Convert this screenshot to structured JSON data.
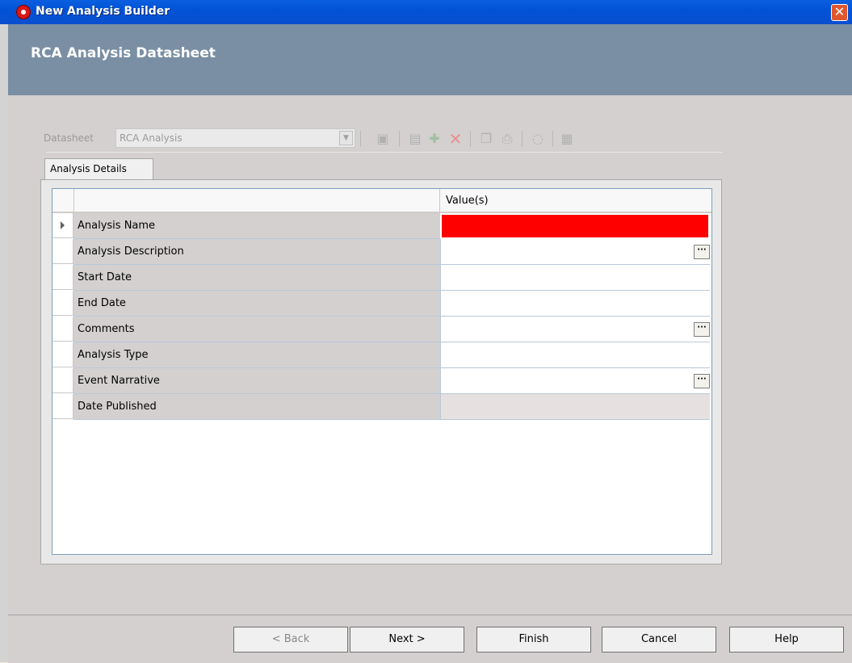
{
  "window": {
    "title": "New Analysis Builder",
    "close_glyph": "✕"
  },
  "header": {
    "title": "RCA Analysis Datasheet"
  },
  "datasheet": {
    "label": "Datasheet",
    "selected": "RCA Analysis"
  },
  "toolbar": {
    "icons": [
      "open-icon",
      "save-icon",
      "save-new-icon",
      "delete-icon",
      "copy-icon",
      "print-icon",
      "help-icon",
      "properties-icon"
    ]
  },
  "tabs": [
    {
      "label": "Analysis Details"
    }
  ],
  "grid": {
    "value_header": "Value(s)",
    "rows": [
      {
        "label": "Analysis Name",
        "value": "",
        "state": "required",
        "ellipsis": false,
        "current": true
      },
      {
        "label": "Analysis Description",
        "value": "",
        "state": "normal",
        "ellipsis": true,
        "current": false
      },
      {
        "label": "Start Date",
        "value": "",
        "state": "normal",
        "ellipsis": false,
        "current": false
      },
      {
        "label": "End Date",
        "value": "",
        "state": "normal",
        "ellipsis": false,
        "current": false
      },
      {
        "label": "Comments",
        "value": "",
        "state": "normal",
        "ellipsis": true,
        "current": false
      },
      {
        "label": "Analysis Type",
        "value": "",
        "state": "normal",
        "ellipsis": false,
        "current": false
      },
      {
        "label": "Event Narrative",
        "value": "",
        "state": "normal",
        "ellipsis": true,
        "current": false
      },
      {
        "label": "Date Published",
        "value": "",
        "state": "readonly",
        "ellipsis": false,
        "current": false
      }
    ]
  },
  "buttons": {
    "back": "< Back",
    "next": "Next >",
    "finish": "Finish",
    "cancel": "Cancel",
    "help": "Help"
  },
  "colors": {
    "titlebar": "#0A5FE0",
    "header": "#7A8FA3",
    "required": "#FF0000"
  }
}
